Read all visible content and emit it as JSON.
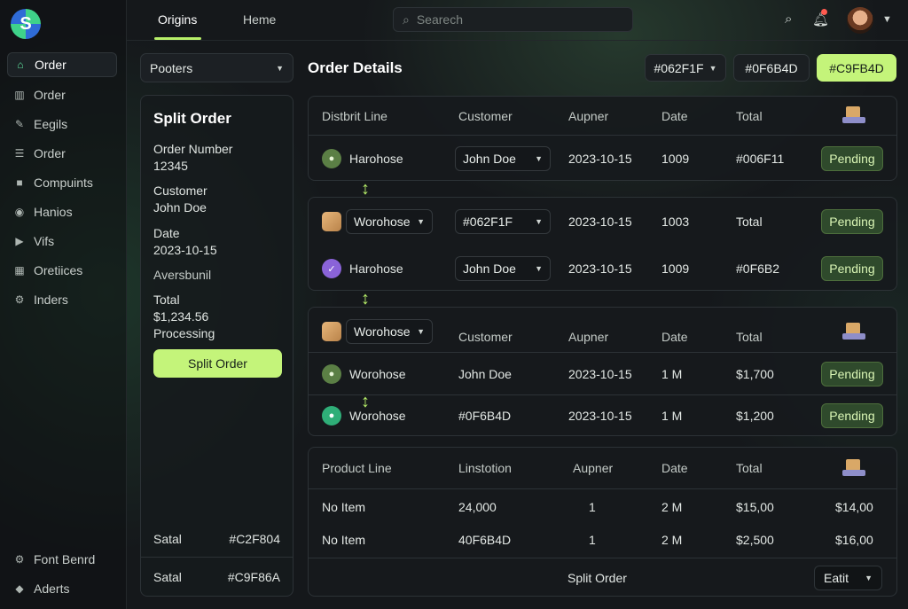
{
  "sidebar": {
    "items": [
      {
        "label": "Order",
        "icon": "home-icon"
      },
      {
        "label": "Order",
        "icon": "building-icon"
      },
      {
        "label": "Eegils",
        "icon": "pen-icon"
      },
      {
        "label": "Order",
        "icon": "list-icon"
      },
      {
        "label": "Compuints",
        "icon": "briefcase-icon"
      },
      {
        "label": "Hanios",
        "icon": "circle-icon"
      },
      {
        "label": "Vifs",
        "icon": "play-icon"
      },
      {
        "label": "Oretiices",
        "icon": "grid-icon"
      },
      {
        "label": "Inders",
        "icon": "gear-icon"
      }
    ],
    "bottom": [
      {
        "label": "Font Benrd",
        "icon": "gear-icon"
      },
      {
        "label": "Aderts",
        "icon": "alert-icon"
      }
    ]
  },
  "topbar": {
    "tabs": [
      "Origins",
      "Heme"
    ],
    "search_placeholder": "Searech"
  },
  "left": {
    "dropdown": "Pooters",
    "title": "Split Order",
    "order_number_label": "Order Number",
    "order_number": "12345",
    "customer_label": "Customer",
    "customer": "John Doe",
    "date_label": "Date",
    "date": "2023-10-15",
    "aversbunil": "Aversbunil",
    "total_label": "Total",
    "total": "$1,234.56",
    "status": "Processing",
    "button": "Split Order",
    "footer": [
      {
        "label": "Satal",
        "value": "#C2F804"
      },
      {
        "label": "Satal",
        "value": "#C9F86A"
      }
    ]
  },
  "header": {
    "title": "Order Details",
    "btn1": "#062F1F",
    "btn2": "#0F6B4D",
    "btn3": "#C9FB4D"
  },
  "card1": {
    "head": [
      "Distbrit Line",
      "Customer",
      "Aupner",
      "Date",
      "Total"
    ],
    "row": {
      "name": "Harohose",
      "customer": "John Doe",
      "date": "2023-10-15",
      "num": "1009",
      "total": "#006F11",
      "status": "Pending"
    }
  },
  "card2": {
    "rows": [
      {
        "name": "Worohose",
        "customer": "#062F1F",
        "date": "2023-10-15",
        "num": "1003",
        "total": "Total",
        "status": "Pending"
      },
      {
        "name": "Harohose",
        "customer": "John Doe",
        "date": "2023-10-15",
        "num": "1009",
        "total": "#0F6B2",
        "status": "Pending"
      }
    ]
  },
  "card3": {
    "head": {
      "name": "Worohose",
      "customer": "Customer",
      "aupner": "Aupner",
      "date": "Date",
      "total": "Total"
    },
    "rows": [
      {
        "name": "Worohose",
        "customer": "John Doe",
        "date": "2023-10-15",
        "num": "1 M",
        "total": "$1,700",
        "status": "Pending"
      },
      {
        "name": "Worohose",
        "customer": "#0F6B4D",
        "date": "2023-10-15",
        "num": "1 M",
        "total": "$1,200",
        "status": "Pending"
      }
    ]
  },
  "card4": {
    "head": [
      "Product Line",
      "Linstotion",
      "Aupner",
      "Date",
      "Total"
    ],
    "rows": [
      {
        "name": "No Item",
        "c2": "24,000",
        "c3": "1",
        "c4": "2 M",
        "c5": "$15,00",
        "c6": "$14,00"
      },
      {
        "name": "No Item",
        "c2": "40F6B4D",
        "c3": "1",
        "c4": "2 M",
        "c5": "$2,500",
        "c6": "$16,00"
      }
    ],
    "footer_label": "Split Order",
    "edit": "Eatit"
  },
  "colors": {
    "accent": "#C4F47A",
    "pending_bg": "#2F4A2C",
    "notification": "#FF5A4F"
  }
}
